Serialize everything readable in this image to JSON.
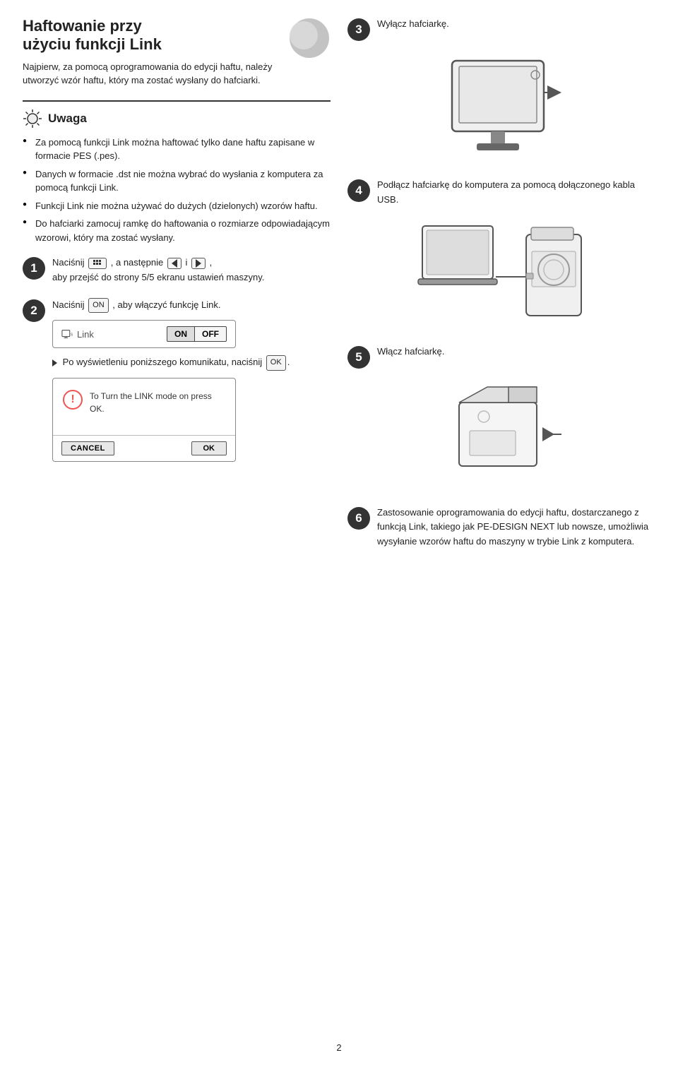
{
  "page": {
    "number": "2",
    "title_line1": "Haftowanie przy",
    "title_line2": "użyciu funkcji Link",
    "intro": "Najpierw, za pomocą oprogramowania do edycji haftu, należy utworzyć wzór haftu, który ma zostać wysłany do hafciarki.",
    "warning_title": "Uwaga",
    "warning_items": [
      "Za pomocą funkcji Link można haftować tylko dane haftu zapisane w formacie PES (.pes).",
      "Danych w formacie .dst nie można wybrać do wysłania z komputera za pomocą funkcji Link.",
      "Funkcji Link nie można używać do dużych (dzielonych) wzorów haftu.",
      "Do hafciarki zamocuj ramkę do haftowania o rozmiarze odpowiadającym wzorowi, który ma zostać wysłany."
    ],
    "steps": {
      "step1": {
        "number": "1",
        "text1": "Naciśnij",
        "text2": ", a następnie",
        "text3": "i",
        "text4": ",",
        "text5": "aby przejść do strony 5/5 ekranu ustawień maszyny."
      },
      "step2": {
        "number": "2",
        "text": "Naciśnij",
        "btn_label": "ON",
        "text2": ", aby włączyć funkcję Link."
      },
      "step2_sub1": "Po wyświetleniu poniższego komunikatu, naciśnij",
      "step2_sub1_btn": "OK",
      "link_ui": {
        "label": "Link",
        "on_label": "ON",
        "off_label": "OFF"
      },
      "dialog": {
        "icon": "!",
        "text": "To Turn the LINK mode on press OK.",
        "cancel_label": "CANCEL",
        "ok_label": "OK"
      },
      "step3": {
        "number": "3",
        "text": "Wyłącz hafciarkę."
      },
      "step4": {
        "number": "4",
        "text": "Podłącz hafciarkę do komputera za pomocą dołączonego kabla USB."
      },
      "step5": {
        "number": "5",
        "text": "Włącz hafciarkę."
      },
      "step6": {
        "number": "6",
        "text": "Zastosowanie oprogramowania do edycji haftu, dostarczanego z funkcją Link, takiego jak PE-DESIGN NEXT lub nowsze, umożliwia wysyłanie wzorów haftu do maszyny w trybie Link z komputera."
      }
    }
  }
}
